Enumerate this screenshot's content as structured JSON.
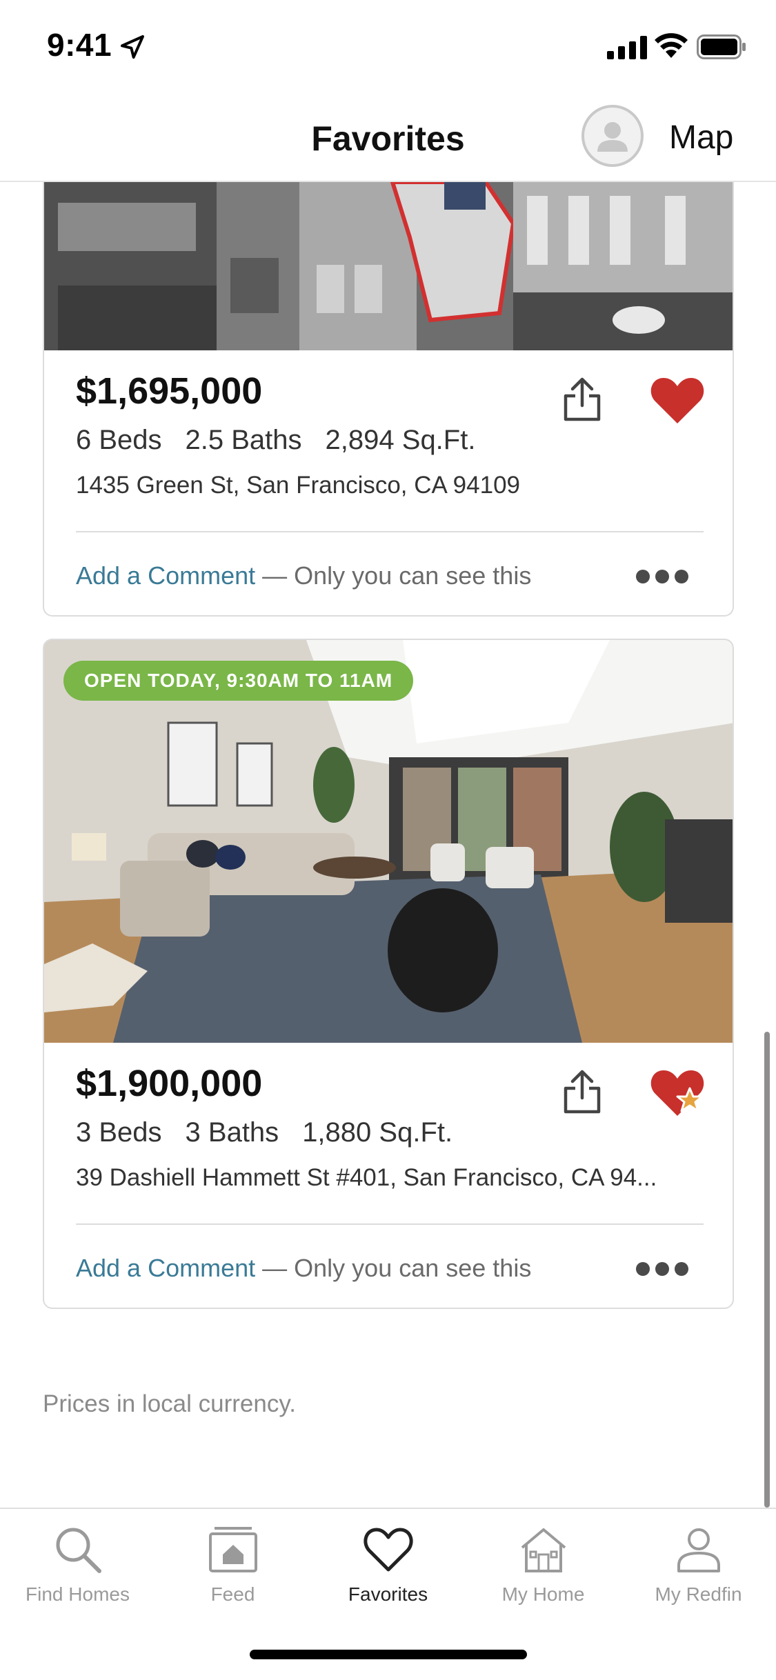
{
  "status_bar": {
    "time": "9:41"
  },
  "header": {
    "title": "Favorites",
    "map_label": "Map"
  },
  "listings": [
    {
      "price": "$1,695,000",
      "beds": "6 Beds",
      "baths": "2.5 Baths",
      "sqft": "2,894 Sq.Ft.",
      "address": "1435 Green St, San Francisco, CA 94109",
      "comment_link": "Add a Comment",
      "comment_note": "— Only you can see this",
      "heart_color": "#c8302c"
    },
    {
      "badge": "OPEN TODAY, 9:30AM TO 11AM",
      "price": "$1,900,000",
      "beds": "3 Beds",
      "baths": "3 Baths",
      "sqft": "1,880 Sq.Ft.",
      "address": "39 Dashiell Hammett St #401, San Francisco, CA 94...",
      "comment_link": "Add a Comment",
      "comment_note": "— Only you can see this",
      "heart_color": "#c8302c",
      "star_color": "#e7a33e"
    }
  ],
  "footnote": "Prices in local currency.",
  "tabs": [
    {
      "label": "Find Homes",
      "icon": "search-icon"
    },
    {
      "label": "Feed",
      "icon": "feed-icon"
    },
    {
      "label": "Favorites",
      "icon": "heart-icon",
      "active": true
    },
    {
      "label": "My Home",
      "icon": "house-icon"
    },
    {
      "label": "My Redfin",
      "icon": "person-icon"
    }
  ],
  "colors": {
    "accent_link": "#3a7a96",
    "badge_green": "#7ab648",
    "favorite_red": "#c8302c"
  }
}
